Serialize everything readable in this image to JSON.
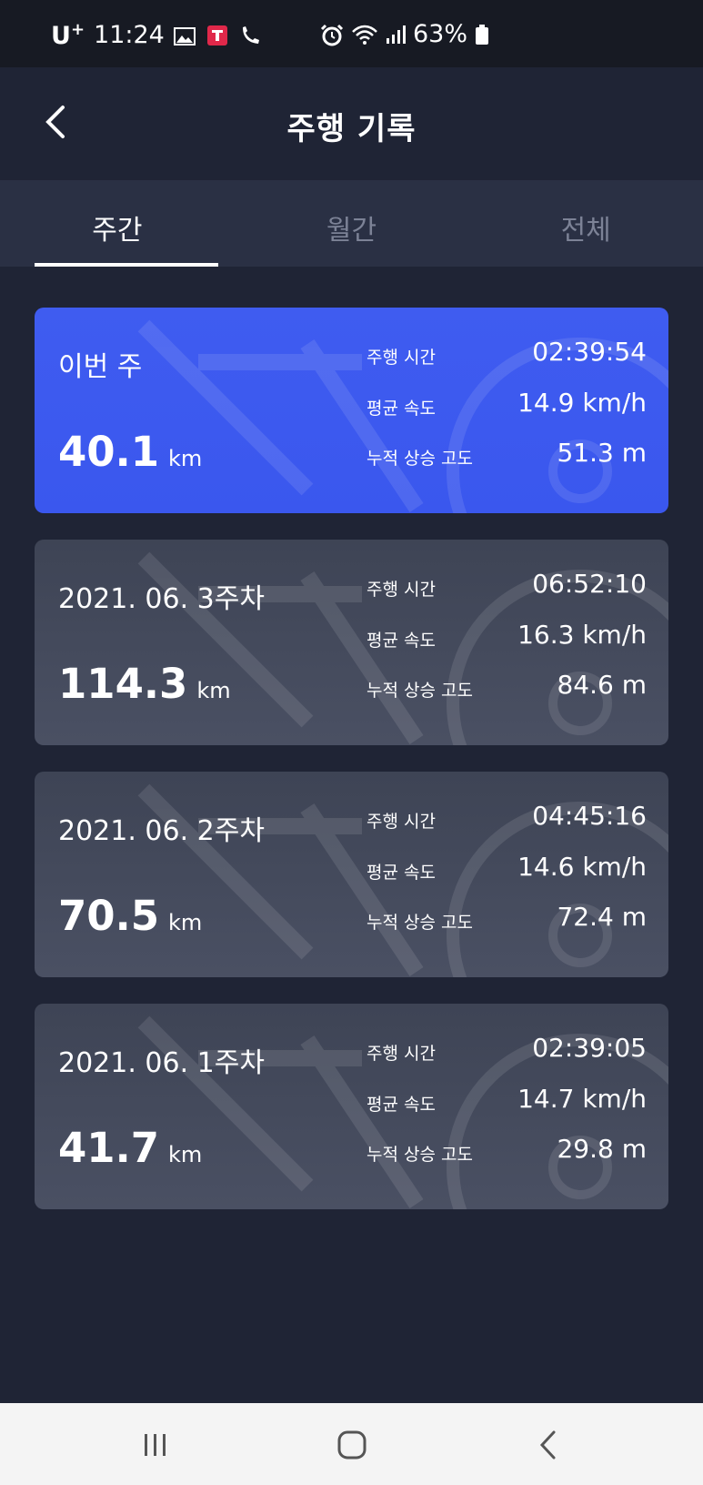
{
  "status_bar": {
    "carrier": "U",
    "carrier_sup": "+",
    "time": "11:24",
    "battery": "63%",
    "icons": [
      "image-icon",
      "app-badge-icon",
      "call-icon",
      "alarm-icon",
      "wifi-icon",
      "signal-icon",
      "battery-icon"
    ]
  },
  "header": {
    "title": "주행 기록"
  },
  "tabs": [
    {
      "label": "주간",
      "active": true
    },
    {
      "label": "월간",
      "active": false
    },
    {
      "label": "전체",
      "active": false
    }
  ],
  "records": [
    {
      "period": "이번 주",
      "distance": "40.1",
      "unit": "km",
      "ride_time_label": "주행 시간",
      "ride_time": "02:39:54",
      "avg_speed_label": "평균 속도",
      "avg_speed": "14.9 km/h",
      "elevation_label": "누적 상승 고도",
      "elevation": "51.3 m"
    },
    {
      "period": "2021. 06. 3주차",
      "distance": "114.3",
      "unit": "km",
      "ride_time_label": "주행 시간",
      "ride_time": "06:52:10",
      "avg_speed_label": "평균 속도",
      "avg_speed": "16.3 km/h",
      "elevation_label": "누적 상승 고도",
      "elevation": "84.6 m"
    },
    {
      "period": "2021. 06. 2주차",
      "distance": "70.5",
      "unit": "km",
      "ride_time_label": "주행 시간",
      "ride_time": "04:45:16",
      "avg_speed_label": "평균 속도",
      "avg_speed": "14.6 km/h",
      "elevation_label": "누적 상승 고도",
      "elevation": "72.4 m"
    },
    {
      "period": "2021. 06. 1주차",
      "distance": "41.7",
      "unit": "km",
      "ride_time_label": "주행 시간",
      "ride_time": "02:39:05",
      "avg_speed_label": "평균 속도",
      "avg_speed": "14.7 km/h",
      "elevation_label": "누적 상승 고도",
      "elevation": "29.8 m"
    }
  ],
  "colors": {
    "background": "#1f2435",
    "tab_bar": "#2a3044",
    "current_card": "#3f5cf0",
    "past_card": "#444a5c",
    "inactive_tab": "#7c8296"
  },
  "nav_bar": {
    "icons": [
      "recent-apps-icon",
      "home-icon",
      "back-icon"
    ]
  }
}
